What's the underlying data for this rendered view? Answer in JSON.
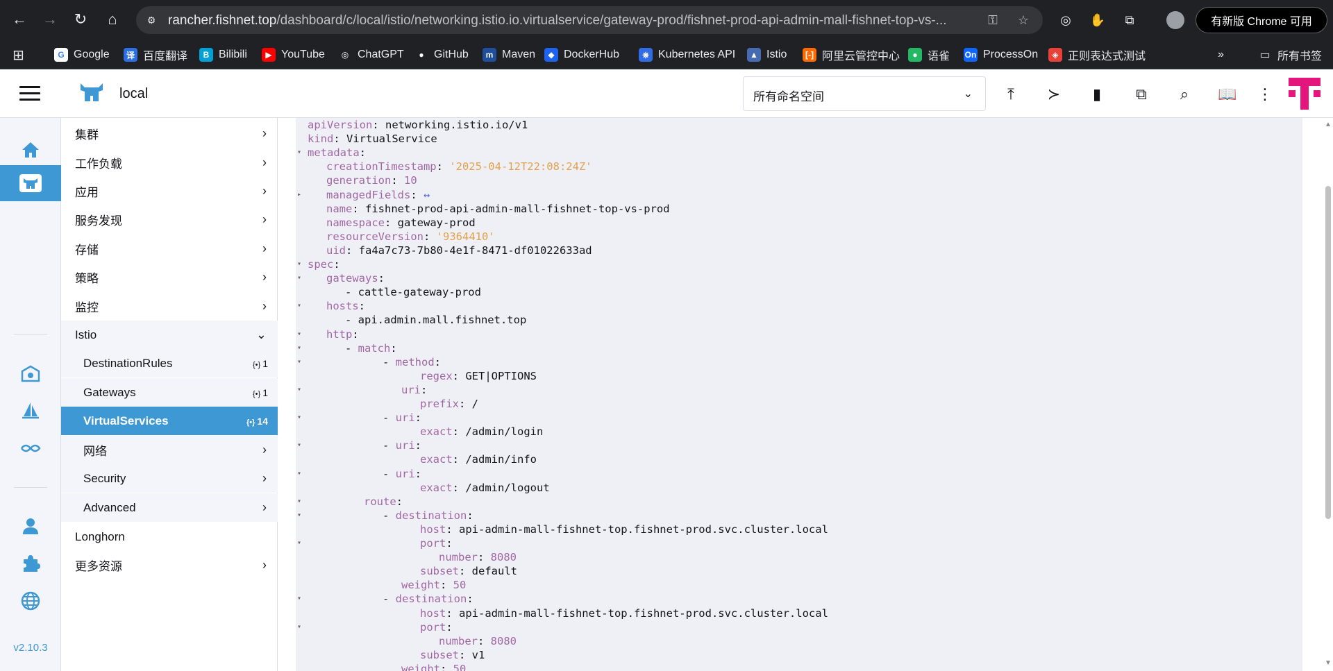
{
  "browser": {
    "url_host": "rancher.fishnet.top",
    "url_path": "/dashboard/c/local/istio/networking.istio.io.virtualservice/gateway-prod/fishnet-prod-api-admin-mall-fishnet-top-vs-...",
    "update_label": "有新版 Chrome 可用",
    "bookmarks": [
      "Google",
      "百度翻译",
      "Bilibili",
      "YouTube",
      "ChatGPT",
      "GitHub",
      "Maven",
      "DockerHub",
      "Kubernetes API",
      "Istio",
      "阿里云管控中心",
      "语雀",
      "ProcessOn",
      "正则表达式测试"
    ],
    "all_bookmarks": "所有书签"
  },
  "header": {
    "cluster": "local",
    "namespace_select": "所有命名空间"
  },
  "rail": {
    "version": "v2.10.3"
  },
  "sidenav": {
    "items": [
      {
        "label": "集群",
        "arrow": "›"
      },
      {
        "label": "工作负载",
        "arrow": "›"
      },
      {
        "label": "应用",
        "arrow": "›"
      },
      {
        "label": "服务发现",
        "arrow": "›"
      },
      {
        "label": "存储",
        "arrow": "›"
      },
      {
        "label": "策略",
        "arrow": "›"
      },
      {
        "label": "监控",
        "arrow": "›"
      },
      {
        "label": "Istio",
        "arrow": "⌄"
      },
      {
        "label": "DestinationRules",
        "count": "1"
      },
      {
        "label": "Gateways",
        "count": "1"
      },
      {
        "label": "VirtualServices",
        "count": "14"
      },
      {
        "label": "网络",
        "arrow": "›"
      },
      {
        "label": "Security",
        "arrow": "›"
      },
      {
        "label": "Advanced",
        "arrow": "›"
      },
      {
        "label": "Longhorn"
      },
      {
        "label": "更多资源",
        "arrow": "›"
      }
    ]
  },
  "yaml": [
    {
      "indent": 0,
      "key": "apiVersion",
      "val": "networking.istio.io/v1",
      "vtype": "v"
    },
    {
      "indent": 0,
      "key": "kind",
      "val": "VirtualService",
      "vtype": "v"
    },
    {
      "indent": 0,
      "key": "metadata",
      "val": "",
      "vtype": "v",
      "fold": "▾"
    },
    {
      "indent": 1,
      "key": "creationTimestamp",
      "val": "'2025-04-12T22:08:24Z'",
      "vtype": "s"
    },
    {
      "indent": 1,
      "key": "generation",
      "val": "10",
      "vtype": "n"
    },
    {
      "indent": 1,
      "key": "managedFields",
      "val": "↔",
      "vtype": "ex",
      "fold": "▸"
    },
    {
      "indent": 1,
      "key": "name",
      "val": "fishnet-prod-api-admin-mall-fishnet-top-vs-prod",
      "vtype": "v"
    },
    {
      "indent": 1,
      "key": "namespace",
      "val": "gateway-prod",
      "vtype": "v"
    },
    {
      "indent": 1,
      "key": "resourceVersion",
      "val": "'9364410'",
      "vtype": "s"
    },
    {
      "indent": 1,
      "key": "uid",
      "val": "fa4a7c73-7b80-4e1f-8471-df01022633ad",
      "vtype": "v"
    },
    {
      "indent": 0,
      "key": "spec",
      "val": "",
      "vtype": "v",
      "fold": "▾"
    },
    {
      "indent": 1,
      "key": "gateways",
      "val": "",
      "vtype": "v",
      "fold": "▾"
    },
    {
      "indent": 2,
      "dash": true,
      "key": "",
      "val": "cattle-gateway-prod",
      "vtype": "v"
    },
    {
      "indent": 1,
      "key": "hosts",
      "val": "",
      "vtype": "v",
      "fold": "▾"
    },
    {
      "indent": 2,
      "dash": true,
      "key": "",
      "val": "api.admin.mall.fishnet.top",
      "vtype": "v"
    },
    {
      "indent": 1,
      "key": "http",
      "val": "",
      "vtype": "v",
      "fold": "▾"
    },
    {
      "indent": 2,
      "dash": true,
      "key": "match",
      "val": "",
      "vtype": "v",
      "fold": "▾"
    },
    {
      "indent": 4,
      "dash": true,
      "key": "method",
      "val": "",
      "vtype": "v",
      "fold": "▾"
    },
    {
      "indent": 6,
      "key": "regex",
      "val": "GET|OPTIONS",
      "vtype": "v"
    },
    {
      "indent": 5,
      "key": "uri",
      "val": "",
      "vtype": "v",
      "fold": "▾"
    },
    {
      "indent": 6,
      "key": "prefix",
      "val": "/",
      "vtype": "v"
    },
    {
      "indent": 4,
      "dash": true,
      "key": "uri",
      "val": "",
      "vtype": "v",
      "fold": "▾"
    },
    {
      "indent": 6,
      "key": "exact",
      "val": "/admin/login",
      "vtype": "v"
    },
    {
      "indent": 4,
      "dash": true,
      "key": "uri",
      "val": "",
      "vtype": "v",
      "fold": "▾"
    },
    {
      "indent": 6,
      "key": "exact",
      "val": "/admin/info",
      "vtype": "v"
    },
    {
      "indent": 4,
      "dash": true,
      "key": "uri",
      "val": "",
      "vtype": "v",
      "fold": "▾"
    },
    {
      "indent": 6,
      "key": "exact",
      "val": "/admin/logout",
      "vtype": "v"
    },
    {
      "indent": 3,
      "key": "route",
      "val": "",
      "vtype": "v",
      "fold": "▾"
    },
    {
      "indent": 4,
      "dash": true,
      "key": "destination",
      "val": "",
      "vtype": "v",
      "fold": "▾"
    },
    {
      "indent": 6,
      "key": "host",
      "val": "api-admin-mall-fishnet-top.fishnet-prod.svc.cluster.local",
      "vtype": "v"
    },
    {
      "indent": 6,
      "key": "port",
      "val": "",
      "vtype": "v",
      "fold": "▾"
    },
    {
      "indent": 7,
      "key": "number",
      "val": "8080",
      "vtype": "n"
    },
    {
      "indent": 6,
      "key": "subset",
      "val": "default",
      "vtype": "v"
    },
    {
      "indent": 5,
      "key": "weight",
      "val": "50",
      "vtype": "n"
    },
    {
      "indent": 4,
      "dash": true,
      "key": "destination",
      "val": "",
      "vtype": "v",
      "fold": "▾"
    },
    {
      "indent": 6,
      "key": "host",
      "val": "api-admin-mall-fishnet-top.fishnet-prod.svc.cluster.local",
      "vtype": "v"
    },
    {
      "indent": 6,
      "key": "port",
      "val": "",
      "vtype": "v",
      "fold": "▾"
    },
    {
      "indent": 7,
      "key": "number",
      "val": "8080",
      "vtype": "n"
    },
    {
      "indent": 6,
      "key": "subset",
      "val": "v1",
      "vtype": "v"
    },
    {
      "indent": 5,
      "key": "weight",
      "val": "50",
      "vtype": "n"
    }
  ]
}
